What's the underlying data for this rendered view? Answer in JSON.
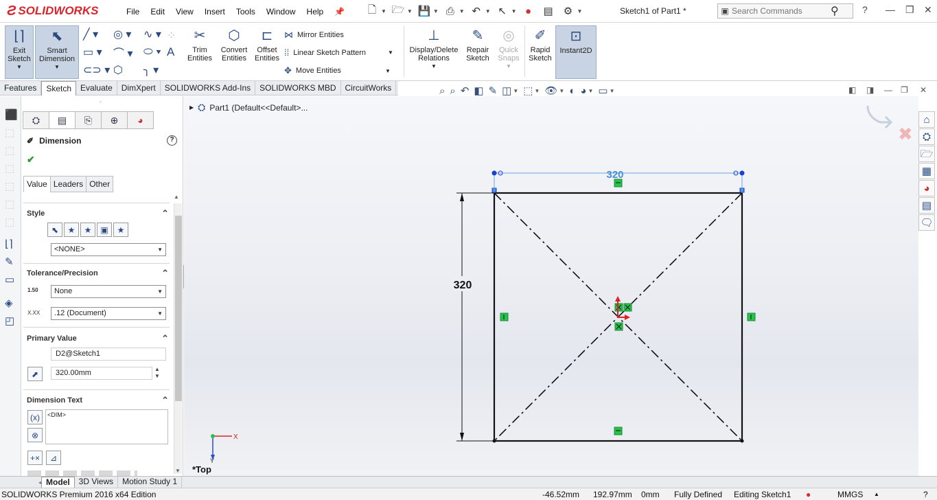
{
  "app": {
    "brand": "SOLIDWORKS",
    "doc_title": "Sketch1 of Part1 *"
  },
  "menu": [
    "File",
    "Edit",
    "View",
    "Insert",
    "Tools",
    "Window",
    "Help"
  ],
  "search": {
    "placeholder": "Search Commands"
  },
  "ribbon": {
    "exit_sketch": "Exit Sketch",
    "smart_dimension": "Smart Dimension",
    "trim": "Trim Entities",
    "convert": "Convert Entities",
    "offset": "Offset Entities",
    "mirror": "Mirror Entities",
    "linear_pattern": "Linear Sketch Pattern",
    "move": "Move Entities",
    "display_delete": "Display/Delete Relations",
    "repair": "Repair Sketch",
    "quick_snaps": "Quick Snaps",
    "rapid": "Rapid Sketch",
    "instant2d": "Instant2D"
  },
  "tabs": [
    "Features",
    "Sketch",
    "Evaluate",
    "DimXpert",
    "SOLIDWORKS Add-Ins",
    "SOLIDWORKS MBD",
    "CircuitWorks"
  ],
  "property": {
    "title": "Dimension",
    "subtabs": [
      "Value",
      "Leaders",
      "Other"
    ],
    "style": {
      "heading": "Style",
      "select": "<NONE>"
    },
    "tolerance": {
      "heading": "Tolerance/Precision",
      "type": "None",
      "precision": ".12 (Document)",
      "tol_icon_text": "1.50",
      "prec_icon_text": "X.XX"
    },
    "primary": {
      "heading": "Primary Value",
      "name": "D2@Sketch1",
      "value": "320.00mm"
    },
    "dimtext": {
      "heading": "Dimension Text",
      "text": "<DIM>"
    }
  },
  "tree": {
    "root": "Part1  (Default<<Default>..."
  },
  "sketch": {
    "horizontal_dim": "320",
    "vertical_dim": "320",
    "view_label": "*Top",
    "triad_x": "X",
    "triad_y": "Y"
  },
  "bottom_tabs": [
    "Model",
    "3D Views",
    "Motion Study 1"
  ],
  "status": {
    "edition": "SOLIDWORKS Premium 2016 x64 Edition",
    "x": "-46.52mm",
    "y": "192.97mm",
    "z": "0mm",
    "state": "Fully Defined",
    "mode": "Editing Sketch1",
    "units": "MMGS"
  },
  "colors": {
    "brand_red": "#d8262e",
    "dim_blue": "#4a90d9",
    "relation_green": "#27c24c",
    "selected_blue": "#1a3fd1"
  }
}
